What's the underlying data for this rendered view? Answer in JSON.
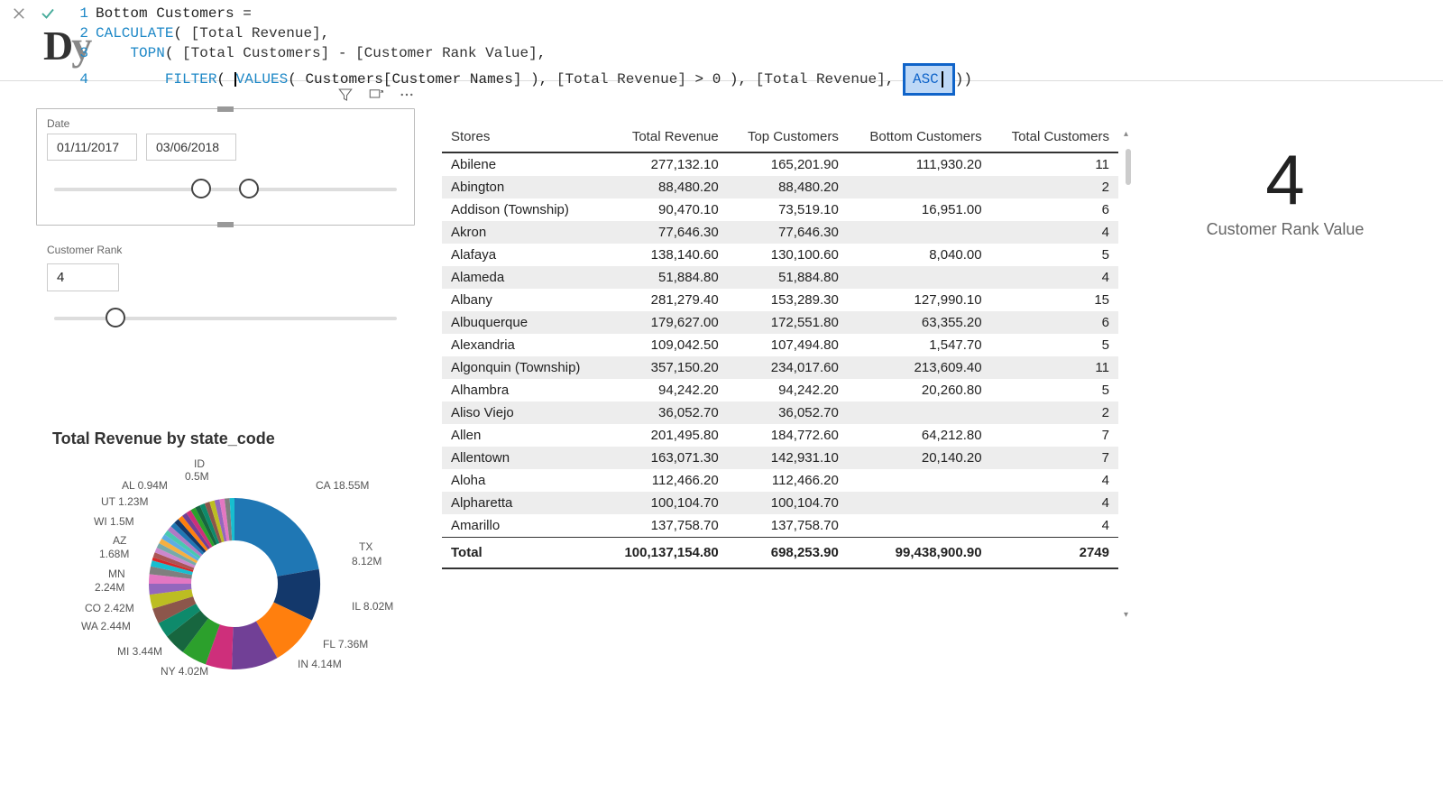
{
  "formula": {
    "line1_num": "1",
    "line1": "Bottom Customers =",
    "line2_num": "2",
    "line2_a": "CALCULATE",
    "line2_b": "( ",
    "line2_c": "[Total Revenue]",
    "line2_d": ",",
    "line3_num": "3",
    "line3_a": "    TOPN",
    "line3_b": "( ",
    "line3_c": "[Total Customers]",
    "line3_d": " - ",
    "line3_e": "[Customer Rank Value]",
    "line3_f": ",",
    "line4_num": "4",
    "line4_a": "        FILTER",
    "line4_b": "( ",
    "line4_c": "VALUES",
    "line4_d": "( Customers[Customer Names] ), ",
    "line4_e": "[Total Revenue]",
    "line4_f": " > 0 ), ",
    "line4_g": "[Total Revenue]",
    "line4_h": ", ",
    "line4_asc": "ASC",
    "line4_tail": "))"
  },
  "logo_a": "D",
  "logo_b": "y",
  "date_slicer": {
    "title": "Date",
    "from": "01/11/2017",
    "to": "03/06/2018"
  },
  "rank_slicer": {
    "title": "Customer Rank",
    "value": "4"
  },
  "table": {
    "headers": [
      "Stores",
      "Total Revenue",
      "Top Customers",
      "Bottom Customers",
      "Total Customers"
    ],
    "rows": [
      [
        "Abilene",
        "277,132.10",
        "165,201.90",
        "111,930.20",
        "11"
      ],
      [
        "Abington",
        "88,480.20",
        "88,480.20",
        "",
        "2"
      ],
      [
        "Addison (Township)",
        "90,470.10",
        "73,519.10",
        "16,951.00",
        "6"
      ],
      [
        "Akron",
        "77,646.30",
        "77,646.30",
        "",
        "4"
      ],
      [
        "Alafaya",
        "138,140.60",
        "130,100.60",
        "8,040.00",
        "5"
      ],
      [
        "Alameda",
        "51,884.80",
        "51,884.80",
        "",
        "4"
      ],
      [
        "Albany",
        "281,279.40",
        "153,289.30",
        "127,990.10",
        "15"
      ],
      [
        "Albuquerque",
        "179,627.00",
        "172,551.80",
        "63,355.20",
        "6"
      ],
      [
        "Alexandria",
        "109,042.50",
        "107,494.80",
        "1,547.70",
        "5"
      ],
      [
        "Algonquin (Township)",
        "357,150.20",
        "234,017.60",
        "213,609.40",
        "11"
      ],
      [
        "Alhambra",
        "94,242.20",
        "94,242.20",
        "20,260.80",
        "5"
      ],
      [
        "Aliso Viejo",
        "36,052.70",
        "36,052.70",
        "",
        "2"
      ],
      [
        "Allen",
        "201,495.80",
        "184,772.60",
        "64,212.80",
        "7"
      ],
      [
        "Allentown",
        "163,071.30",
        "142,931.10",
        "20,140.20",
        "7"
      ],
      [
        "Aloha",
        "112,466.20",
        "112,466.20",
        "",
        "4"
      ],
      [
        "Alpharetta",
        "100,104.70",
        "100,104.70",
        "",
        "4"
      ],
      [
        "Amarillo",
        "137,758.70",
        "137,758.70",
        "",
        "4"
      ]
    ],
    "total": [
      "Total",
      "100,137,154.80",
      "698,253.90",
      "99,438,900.90",
      "2749"
    ]
  },
  "card": {
    "value": "4",
    "label": "Customer Rank Value"
  },
  "donut": {
    "title": "Total Revenue by state_code",
    "labels": {
      "id": "ID",
      "id2": "0.5M",
      "al": "AL 0.94M",
      "ut": "UT 1.23M",
      "wi": "WI 1.5M",
      "az": "AZ",
      "az2": "1.68M",
      "mn": "MN",
      "mn2": "2.24M",
      "co": "CO 2.42M",
      "wa": "WA 2.44M",
      "mi": "MI 3.44M",
      "ny": "NY 4.02M",
      "in": "IN 4.14M",
      "fl": "FL 7.36M",
      "il": "IL 8.02M",
      "tx": "TX",
      "tx2": "8.12M",
      "ca": "CA 18.55M"
    }
  },
  "chart_data": {
    "type": "pie",
    "title": "Total Revenue by state_code",
    "series": [
      {
        "name": "CA",
        "value": 18.55
      },
      {
        "name": "TX",
        "value": 8.12
      },
      {
        "name": "IL",
        "value": 8.02
      },
      {
        "name": "FL",
        "value": 7.36
      },
      {
        "name": "IN",
        "value": 4.14
      },
      {
        "name": "NY",
        "value": 4.02
      },
      {
        "name": "MI",
        "value": 3.44
      },
      {
        "name": "WA",
        "value": 2.44
      },
      {
        "name": "CO",
        "value": 2.42
      },
      {
        "name": "MN",
        "value": 2.24
      },
      {
        "name": "AZ",
        "value": 1.68
      },
      {
        "name": "WI",
        "value": 1.5
      },
      {
        "name": "UT",
        "value": 1.23
      },
      {
        "name": "AL",
        "value": 0.94
      },
      {
        "name": "ID",
        "value": 0.5
      }
    ],
    "unit": "M"
  }
}
